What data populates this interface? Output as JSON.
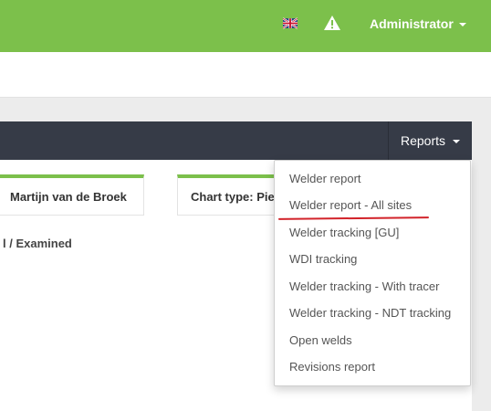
{
  "topbar": {
    "flag_icon": "uk-flag-icon",
    "warning_icon": "warning-icon",
    "user_label": "Administrator"
  },
  "toolbar": {
    "reports_label": "Reports"
  },
  "tiles": [
    {
      "label": "Martijn van de Broek"
    },
    {
      "label": "Chart type: Pie"
    }
  ],
  "content": {
    "examined_label": "l / Examined"
  },
  "reports_menu": {
    "items": [
      {
        "label": "Welder report"
      },
      {
        "label": "Welder report - All sites"
      },
      {
        "label": "Welder tracking [GU]"
      },
      {
        "label": "WDI tracking"
      },
      {
        "label": "Welder tracking - With tracer"
      },
      {
        "label": "Welder tracking - NDT tracking"
      },
      {
        "label": "Open welds"
      },
      {
        "label": "Revisions report"
      }
    ],
    "annotation_color": "#d2232a"
  },
  "colors": {
    "accent_green": "#7cc04b",
    "dark_bar": "#363b47"
  }
}
